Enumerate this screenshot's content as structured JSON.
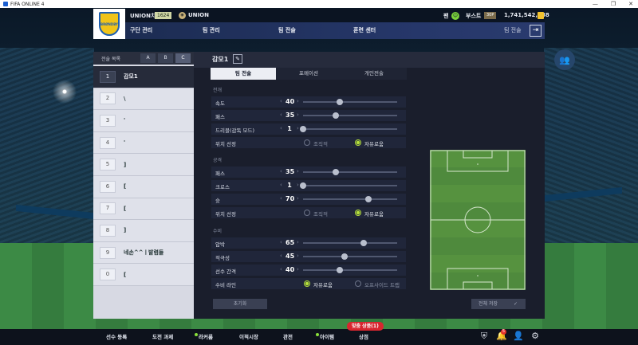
{
  "window": {
    "title": "FIFA ONLINE 4",
    "controls": [
      "—",
      "❐",
      "✕"
    ]
  },
  "header": {
    "club_logo_text": "BRØNDBY",
    "club_name": "UNION치오",
    "ovr": "1624",
    "union_name": "UNION",
    "fan_label": "팬",
    "boost_label": "부스트",
    "boost_badge": "30P",
    "coins": "1,741,542,488"
  },
  "menu": {
    "items": [
      "구단 관리",
      "팀 관리",
      "팀 전술",
      "훈련 센터"
    ],
    "right_label": "팀 전술"
  },
  "tactics_list": {
    "title": "전술 목록",
    "tabs": [
      "A",
      "B",
      "C"
    ],
    "active_tab": "C",
    "slots": [
      {
        "num": "1",
        "name": "감모1"
      },
      {
        "num": "2",
        "name": "\\"
      },
      {
        "num": "3",
        "name": "'"
      },
      {
        "num": "4",
        "name": "'"
      },
      {
        "num": "5",
        "name": "]"
      },
      {
        "num": "6",
        "name": "["
      },
      {
        "num": "7",
        "name": "["
      },
      {
        "num": "8",
        "name": "]"
      },
      {
        "num": "9",
        "name": "네손^^ㅣ발렴들"
      },
      {
        "num": "0",
        "name": "["
      }
    ]
  },
  "main": {
    "title": "감모1",
    "subtabs": [
      "팀 전술",
      "포메이션",
      "개인전술"
    ],
    "sections": {
      "buildup": {
        "title": "전개",
        "speed": {
          "label": "속도",
          "value": 40
        },
        "passing": {
          "label": "패스",
          "value": 35
        },
        "dribbling": {
          "label": "드리블(감독 모드)",
          "value": 1
        },
        "positioning": {
          "label": "위치 선정",
          "opt1": "조직적",
          "opt2": "자유로움",
          "selected": "자유로움"
        }
      },
      "chance": {
        "title": "공격",
        "passing": {
          "label": "패스",
          "value": 35
        },
        "crossing": {
          "label": "크로스",
          "value": 1
        },
        "shooting": {
          "label": "슛",
          "value": 70
        },
        "positioning": {
          "label": "위치 선정",
          "opt1": "조직적",
          "opt2": "자유로움",
          "selected": "자유로움"
        }
      },
      "defence": {
        "title": "수비",
        "pressure": {
          "label": "압박",
          "value": 65
        },
        "aggression": {
          "label": "적극성",
          "value": 45
        },
        "width": {
          "label": "선수 간격",
          "value": 40
        },
        "line": {
          "label": "수비 라인",
          "opt1": "자유로움",
          "opt2": "오프사이드 트랩",
          "selected": "자유로움"
        }
      }
    },
    "reset_label": "초기화",
    "save_label": "전체 저장"
  },
  "bottom_nav": {
    "items": [
      "선수 등록",
      "도전 과제",
      "라커룸",
      "이적시장",
      "관전",
      "아이템",
      "상점"
    ],
    "promo_badge": "맞춤 상품(1)",
    "notification_count": "5"
  },
  "colors": {
    "accent_green": "#b5e03a",
    "panel_dark": "#1a1e2c",
    "menu_blue": "#26376a",
    "promo_red": "#d8262f"
  }
}
